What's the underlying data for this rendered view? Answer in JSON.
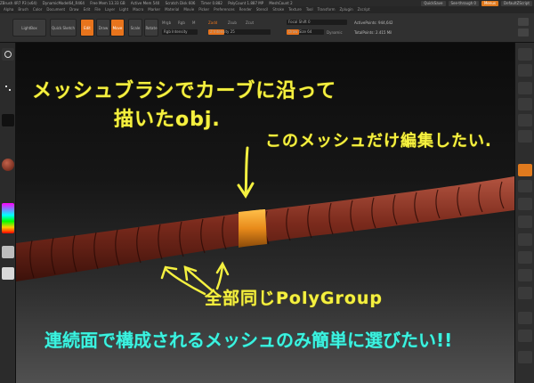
{
  "app": {
    "title_items": [
      "ZBrush 4R7 P3 (x64)",
      "DynamicModel64_R464",
      "Free Mem 13.33 GB",
      "Active Mem 540",
      "Scratch Disk 606",
      "Timer 0.882",
      "PolyCount 1.887 MP",
      "MeshCount 2"
    ],
    "quicksave": "QuickSave",
    "see_through": "See-through 0",
    "menus": "Menus",
    "script": "DefaultZScript"
  },
  "menubar": [
    "Alpha",
    "Brush",
    "Color",
    "Document",
    "Draw",
    "Edit",
    "File",
    "Layer",
    "Light",
    "Macro",
    "Marker",
    "Material",
    "Movie",
    "Picker",
    "Preferences",
    "Render",
    "Stencil",
    "Stroke",
    "Texture",
    "Tool",
    "Transform",
    "Zplugin",
    "Zscript"
  ],
  "shelf": {
    "lightbox": "LightBox",
    "quick_sketch": "Quick Sketch",
    "edit": "Edit",
    "draw": "Draw",
    "move": "Move",
    "scale": "Scale",
    "rotate": "Rotate",
    "mrgb": "Mrgb",
    "rgb": "Rgb",
    "m": "M",
    "zadd": "Zadd",
    "zsub": "Zsub",
    "zcut": "Zcut",
    "rgb_intensity": "Rgb Intensity",
    "z_intensity": "Z Intensity",
    "z_intensity_value": "25",
    "focal_shift_label": "Focal Shift",
    "focal_shift_value": "0",
    "draw_size_label": "Draw Size",
    "draw_size_value": "64",
    "dynamic": "Dynamic",
    "active_points_label": "ActivePoints:",
    "active_points_value": "944,642",
    "total_points_label": "TotalPoints:",
    "total_points_value": "2.415 Mil"
  },
  "annotations": {
    "line1": "メッシュブラシでカーブに沿って",
    "line2": "描いたobj.",
    "edit_note": "このメッシュだけ編集したい.",
    "polygroup_note": "全部同じPolyGroup",
    "bottom_note": "連続面で構成されるメッシュのみ簡単に選びたい!!"
  },
  "colors": {
    "accent": "#e8741c",
    "annot_yellow": "#f4f040",
    "annot_cyan": "#3cf2df",
    "mesh_red": "#7a2a1c",
    "highlight_orange": "#e88a1a"
  }
}
